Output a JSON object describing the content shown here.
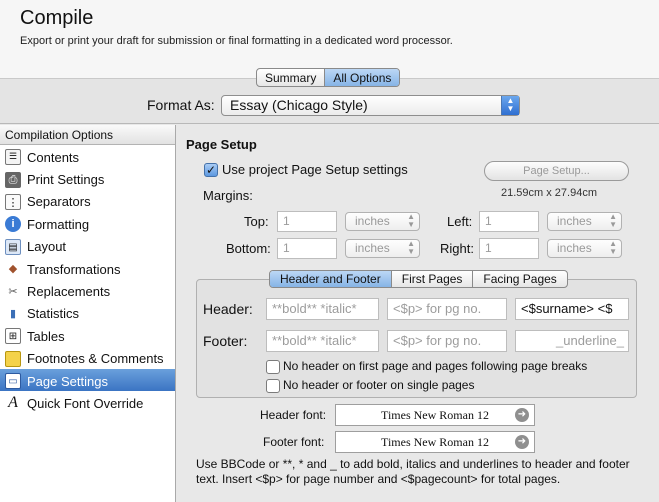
{
  "window": {
    "title": "Compile",
    "subtitle": "Export or print your draft for submission or final formatting in a dedicated word processor."
  },
  "mode_tabs": [
    "Summary",
    "All Options"
  ],
  "format": {
    "label": "Format As:",
    "value": "Essay (Chicago Style)"
  },
  "sidebar": {
    "header": "Compilation Options",
    "items": [
      {
        "label": "Contents",
        "icon": "contents-icon"
      },
      {
        "label": "Print Settings",
        "icon": "printer-icon"
      },
      {
        "label": "Separators",
        "icon": "separators-icon"
      },
      {
        "label": "Formatting",
        "icon": "formatting-icon"
      },
      {
        "label": "Layout",
        "icon": "layout-icon"
      },
      {
        "label": "Transformations",
        "icon": "transformations-icon"
      },
      {
        "label": "Replacements",
        "icon": "replacements-icon"
      },
      {
        "label": "Statistics",
        "icon": "statistics-icon"
      },
      {
        "label": "Tables",
        "icon": "tables-icon"
      },
      {
        "label": "Footnotes & Comments",
        "icon": "footnotes-icon"
      },
      {
        "label": "Page Settings",
        "icon": "page-settings-icon"
      },
      {
        "label": "Quick Font Override",
        "icon": "font-override-icon"
      }
    ],
    "selected": "Page Settings"
  },
  "page_setup": {
    "heading": "Page Setup",
    "use_project_label": "Use project Page Setup settings",
    "use_project_checked": true,
    "page_setup_button": "Page Setup...",
    "paper_size": "21.59cm x 27.94cm",
    "margins_label": "Margins:",
    "top_label": "Top:",
    "top_value": "1",
    "top_unit": "inches",
    "left_label": "Left:",
    "left_value": "1",
    "left_unit": "inches",
    "bottom_label": "Bottom:",
    "bottom_value": "1",
    "bottom_unit": "inches",
    "right_label": "Right:",
    "right_value": "1",
    "right_unit": "inches"
  },
  "header_footer": {
    "tabs": [
      "Header and Footer",
      "First Pages",
      "Facing Pages"
    ],
    "active_tab": "Header and Footer",
    "header_label": "Header:",
    "header_fields": [
      "**bold** *italic*",
      "<$p> for pg no.",
      "<$surname>  <$"
    ],
    "footer_label": "Footer:",
    "footer_fields": [
      "**bold** *italic*",
      "<$p> for pg no.",
      "_underline_"
    ],
    "no_header_first_page": "No header on first page and pages following page breaks",
    "no_header_single": "No header or footer on single pages"
  },
  "fonts": {
    "header_label": "Header font:",
    "header_value": "Times New Roman 12",
    "footer_label": "Footer font:",
    "footer_value": "Times New Roman 12"
  },
  "help_text": "Use BBCode or **, * and _ to add bold, italics and underlines to header and footer text. Insert <$p> for page number and <$pagecount> for total pages."
}
